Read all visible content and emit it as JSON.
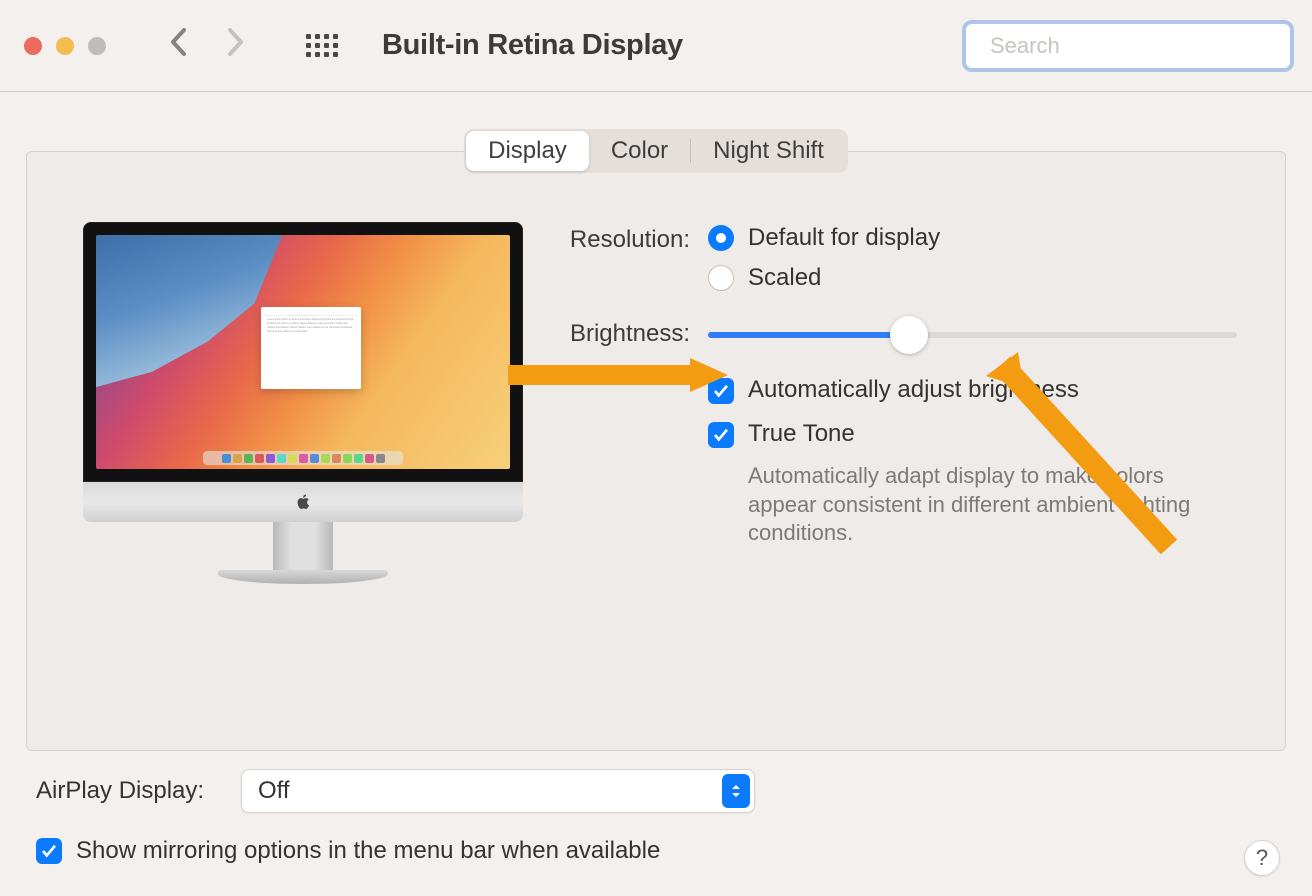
{
  "window": {
    "title": "Built-in Retina Display"
  },
  "search": {
    "placeholder": "Search"
  },
  "tabs": {
    "display": "Display",
    "color": "Color",
    "night_shift": "Night Shift"
  },
  "resolution": {
    "label": "Resolution:",
    "default_label": "Default for display",
    "scaled_label": "Scaled",
    "selected": "default"
  },
  "brightness": {
    "label": "Brightness:",
    "value_percent": 38,
    "auto_checked": true,
    "auto_label": "Automatically adjust brightness"
  },
  "true_tone": {
    "checked": true,
    "label": "True Tone",
    "description": "Automatically adapt display to make colors appear consistent in different ambient lighting conditions."
  },
  "airplay": {
    "label": "AirPlay Display:",
    "value": "Off"
  },
  "mirroring": {
    "checked": true,
    "label": "Show mirroring options in the menu bar when available"
  },
  "help": "?"
}
